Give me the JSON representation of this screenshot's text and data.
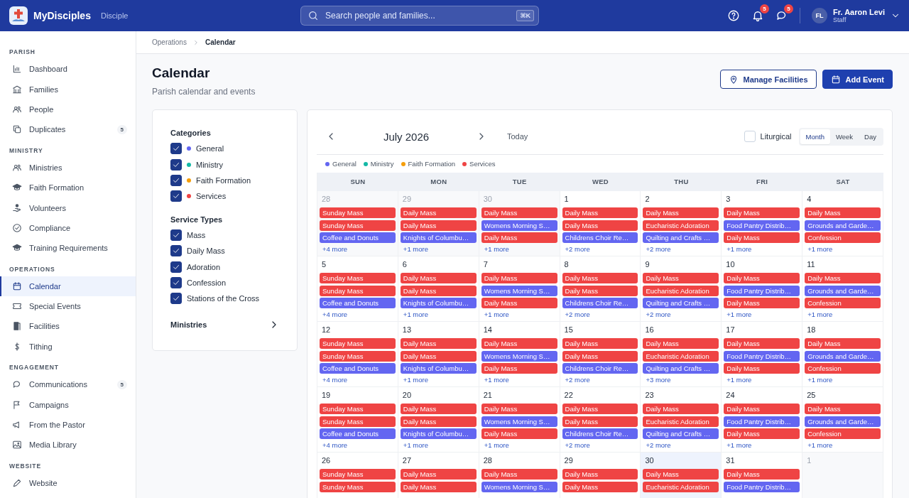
{
  "app": {
    "name": "MyDisciples",
    "edition": "Disciple"
  },
  "search": {
    "placeholder": "Search people and families...",
    "shortcut": "⌘K"
  },
  "notifications": {
    "count": "5"
  },
  "messages": {
    "count": "5"
  },
  "user": {
    "initials": "FL",
    "name": "Fr. Aaron Levi",
    "role": "Staff"
  },
  "sidebar": {
    "sections": [
      {
        "title": "PARISH",
        "items": [
          {
            "label": "Dashboard",
            "selected": false
          },
          {
            "label": "Families",
            "selected": false
          },
          {
            "label": "People",
            "selected": false
          },
          {
            "label": "Duplicates",
            "selected": false,
            "badge": "5"
          }
        ]
      },
      {
        "title": "MINISTRY",
        "items": [
          {
            "label": "Ministries",
            "selected": false
          },
          {
            "label": "Faith Formation",
            "selected": false
          },
          {
            "label": "Volunteers",
            "selected": false
          },
          {
            "label": "Compliance",
            "selected": false
          },
          {
            "label": "Training Requirements",
            "selected": false
          }
        ]
      },
      {
        "title": "OPERATIONS",
        "items": [
          {
            "label": "Calendar",
            "selected": true
          },
          {
            "label": "Special Events",
            "selected": false
          },
          {
            "label": "Facilities",
            "selected": false
          },
          {
            "label": "Tithing",
            "selected": false
          }
        ]
      },
      {
        "title": "ENGAGEMENT",
        "items": [
          {
            "label": "Communications",
            "selected": false,
            "badge": "5"
          },
          {
            "label": "Campaigns",
            "selected": false
          },
          {
            "label": "From the Pastor",
            "selected": false
          },
          {
            "label": "Media Library",
            "selected": false
          }
        ]
      },
      {
        "title": "WEBSITE",
        "items": [
          {
            "label": "Website",
            "selected": false
          }
        ]
      }
    ]
  },
  "breadcrumb": [
    "Operations",
    "Calendar"
  ],
  "page": {
    "title": "Calendar",
    "subtitle": "Parish calendar and events"
  },
  "actions": [
    {
      "label": "Manage Facilities",
      "kind": "outline"
    },
    {
      "label": "Add Event",
      "kind": "primary"
    }
  ],
  "filters": {
    "groups": [
      {
        "title": "Categories",
        "items": [
          {
            "label": "General",
            "checked": true,
            "color": "#6366f1"
          },
          {
            "label": "Ministry",
            "checked": true,
            "color": "#14b8a6"
          },
          {
            "label": "Faith Formation",
            "checked": true,
            "color": "#f59e0b"
          },
          {
            "label": "Services",
            "checked": true,
            "color": "#ef4444"
          }
        ]
      },
      {
        "title": "Service Types",
        "items": [
          {
            "label": "Mass",
            "checked": true
          },
          {
            "label": "Daily Mass",
            "checked": true
          },
          {
            "label": "Adoration",
            "checked": true
          },
          {
            "label": "Confession",
            "checked": true
          },
          {
            "label": "Stations of the Cross",
            "checked": true
          }
        ]
      }
    ],
    "ministries": {
      "label": "Ministries",
      "expanded": false
    }
  },
  "calendar": {
    "month": "July 2026",
    "today_label": "Today",
    "liturgical": {
      "label": "Liturgical",
      "checked": false
    },
    "views": [
      {
        "label": "Month",
        "selected": true
      },
      {
        "label": "Week",
        "selected": false
      },
      {
        "label": "Day",
        "selected": false
      }
    ],
    "legend": [
      {
        "label": "General",
        "color": "#6366f1"
      },
      {
        "label": "Ministry",
        "color": "#14b8a6"
      },
      {
        "label": "Faith Formation",
        "color": "#f59e0b"
      },
      {
        "label": "Services",
        "color": "#ef4444"
      }
    ],
    "weekdays": [
      "SUN",
      "MON",
      "TUE",
      "WED",
      "THU",
      "FRI",
      "SAT"
    ],
    "weeks": [
      [
        {
          "date": "28",
          "muted": true,
          "today": false,
          "events": [
            {
              "title": "Sunday Mass",
              "color": "#ef4444"
            },
            {
              "title": "Sunday Mass",
              "color": "#ef4444"
            },
            {
              "title": "Coffee and Donuts",
              "color": "#6366f1"
            }
          ],
          "more": "+4 more"
        },
        {
          "date": "29",
          "muted": true,
          "today": false,
          "events": [
            {
              "title": "Daily Mass",
              "color": "#ef4444"
            },
            {
              "title": "Daily Mass",
              "color": "#ef4444"
            },
            {
              "title": "Knights of Columbu…",
              "color": "#6366f1"
            }
          ],
          "more": "+1 more"
        },
        {
          "date": "30",
          "muted": true,
          "today": false,
          "events": [
            {
              "title": "Daily Mass",
              "color": "#ef4444"
            },
            {
              "title": "Womens Morning S…",
              "color": "#6366f1"
            },
            {
              "title": "Daily Mass",
              "color": "#ef4444"
            }
          ],
          "more": "+1 more"
        },
        {
          "date": "1",
          "muted": false,
          "today": false,
          "events": [
            {
              "title": "Daily Mass",
              "color": "#ef4444"
            },
            {
              "title": "Daily Mass",
              "color": "#ef4444"
            },
            {
              "title": "Childrens Choir Re…",
              "color": "#6366f1"
            }
          ],
          "more": "+2 more"
        },
        {
          "date": "2",
          "muted": false,
          "today": false,
          "events": [
            {
              "title": "Daily Mass",
              "color": "#ef4444"
            },
            {
              "title": "Eucharistic Adoration",
              "color": "#ef4444"
            },
            {
              "title": "Quilting and Crafts …",
              "color": "#6366f1"
            }
          ],
          "more": "+2 more"
        },
        {
          "date": "3",
          "muted": false,
          "today": false,
          "events": [
            {
              "title": "Daily Mass",
              "color": "#ef4444"
            },
            {
              "title": "Food Pantry Distrib…",
              "color": "#6366f1"
            },
            {
              "title": "Daily Mass",
              "color": "#ef4444"
            }
          ],
          "more": "+1 more"
        },
        {
          "date": "4",
          "muted": false,
          "today": false,
          "events": [
            {
              "title": "Daily Mass",
              "color": "#ef4444"
            },
            {
              "title": "Grounds and Garde…",
              "color": "#6366f1"
            },
            {
              "title": "Confession",
              "color": "#ef4444"
            }
          ],
          "more": "+1 more"
        }
      ],
      [
        {
          "date": "5",
          "muted": false,
          "today": false,
          "events": [
            {
              "title": "Sunday Mass",
              "color": "#ef4444"
            },
            {
              "title": "Sunday Mass",
              "color": "#ef4444"
            },
            {
              "title": "Coffee and Donuts",
              "color": "#6366f1"
            }
          ],
          "more": "+4 more"
        },
        {
          "date": "6",
          "muted": false,
          "today": false,
          "events": [
            {
              "title": "Daily Mass",
              "color": "#ef4444"
            },
            {
              "title": "Daily Mass",
              "color": "#ef4444"
            },
            {
              "title": "Knights of Columbu…",
              "color": "#6366f1"
            }
          ],
          "more": "+1 more"
        },
        {
          "date": "7",
          "muted": false,
          "today": false,
          "events": [
            {
              "title": "Daily Mass",
              "color": "#ef4444"
            },
            {
              "title": "Womens Morning S…",
              "color": "#6366f1"
            },
            {
              "title": "Daily Mass",
              "color": "#ef4444"
            }
          ],
          "more": "+1 more"
        },
        {
          "date": "8",
          "muted": false,
          "today": false,
          "events": [
            {
              "title": "Daily Mass",
              "color": "#ef4444"
            },
            {
              "title": "Daily Mass",
              "color": "#ef4444"
            },
            {
              "title": "Childrens Choir Re…",
              "color": "#6366f1"
            }
          ],
          "more": "+2 more"
        },
        {
          "date": "9",
          "muted": false,
          "today": false,
          "events": [
            {
              "title": "Daily Mass",
              "color": "#ef4444"
            },
            {
              "title": "Eucharistic Adoration",
              "color": "#ef4444"
            },
            {
              "title": "Quilting and Crafts …",
              "color": "#6366f1"
            }
          ],
          "more": "+2 more"
        },
        {
          "date": "10",
          "muted": false,
          "today": false,
          "events": [
            {
              "title": "Daily Mass",
              "color": "#ef4444"
            },
            {
              "title": "Food Pantry Distrib…",
              "color": "#6366f1"
            },
            {
              "title": "Daily Mass",
              "color": "#ef4444"
            }
          ],
          "more": "+1 more"
        },
        {
          "date": "11",
          "muted": false,
          "today": false,
          "events": [
            {
              "title": "Daily Mass",
              "color": "#ef4444"
            },
            {
              "title": "Grounds and Garde…",
              "color": "#6366f1"
            },
            {
              "title": "Confession",
              "color": "#ef4444"
            }
          ],
          "more": "+1 more"
        }
      ],
      [
        {
          "date": "12",
          "muted": false,
          "today": false,
          "events": [
            {
              "title": "Sunday Mass",
              "color": "#ef4444"
            },
            {
              "title": "Sunday Mass",
              "color": "#ef4444"
            },
            {
              "title": "Coffee and Donuts",
              "color": "#6366f1"
            }
          ],
          "more": "+4 more"
        },
        {
          "date": "13",
          "muted": false,
          "today": false,
          "events": [
            {
              "title": "Daily Mass",
              "color": "#ef4444"
            },
            {
              "title": "Daily Mass",
              "color": "#ef4444"
            },
            {
              "title": "Knights of Columbu…",
              "color": "#6366f1"
            }
          ],
          "more": "+1 more"
        },
        {
          "date": "14",
          "muted": false,
          "today": false,
          "events": [
            {
              "title": "Daily Mass",
              "color": "#ef4444"
            },
            {
              "title": "Womens Morning S…",
              "color": "#6366f1"
            },
            {
              "title": "Daily Mass",
              "color": "#ef4444"
            }
          ],
          "more": "+1 more"
        },
        {
          "date": "15",
          "muted": false,
          "today": false,
          "events": [
            {
              "title": "Daily Mass",
              "color": "#ef4444"
            },
            {
              "title": "Daily Mass",
              "color": "#ef4444"
            },
            {
              "title": "Childrens Choir Re…",
              "color": "#6366f1"
            }
          ],
          "more": "+2 more"
        },
        {
          "date": "16",
          "muted": false,
          "today": false,
          "events": [
            {
              "title": "Daily Mass",
              "color": "#ef4444"
            },
            {
              "title": "Eucharistic Adoration",
              "color": "#ef4444"
            },
            {
              "title": "Quilting and Crafts …",
              "color": "#6366f1"
            }
          ],
          "more": "+3 more"
        },
        {
          "date": "17",
          "muted": false,
          "today": false,
          "events": [
            {
              "title": "Daily Mass",
              "color": "#ef4444"
            },
            {
              "title": "Food Pantry Distrib…",
              "color": "#6366f1"
            },
            {
              "title": "Daily Mass",
              "color": "#ef4444"
            }
          ],
          "more": "+1 more"
        },
        {
          "date": "18",
          "muted": false,
          "today": false,
          "events": [
            {
              "title": "Daily Mass",
              "color": "#ef4444"
            },
            {
              "title": "Grounds and Garde…",
              "color": "#6366f1"
            },
            {
              "title": "Confession",
              "color": "#ef4444"
            }
          ],
          "more": "+1 more"
        }
      ],
      [
        {
          "date": "19",
          "muted": false,
          "today": false,
          "events": [
            {
              "title": "Sunday Mass",
              "color": "#ef4444"
            },
            {
              "title": "Sunday Mass",
              "color": "#ef4444"
            },
            {
              "title": "Coffee and Donuts",
              "color": "#6366f1"
            }
          ],
          "more": "+4 more"
        },
        {
          "date": "20",
          "muted": false,
          "today": false,
          "events": [
            {
              "title": "Daily Mass",
              "color": "#ef4444"
            },
            {
              "title": "Daily Mass",
              "color": "#ef4444"
            },
            {
              "title": "Knights of Columbu…",
              "color": "#6366f1"
            }
          ],
          "more": "+1 more"
        },
        {
          "date": "21",
          "muted": false,
          "today": false,
          "events": [
            {
              "title": "Daily Mass",
              "color": "#ef4444"
            },
            {
              "title": "Womens Morning S…",
              "color": "#6366f1"
            },
            {
              "title": "Daily Mass",
              "color": "#ef4444"
            }
          ],
          "more": "+1 more"
        },
        {
          "date": "22",
          "muted": false,
          "today": false,
          "events": [
            {
              "title": "Daily Mass",
              "color": "#ef4444"
            },
            {
              "title": "Daily Mass",
              "color": "#ef4444"
            },
            {
              "title": "Childrens Choir Re…",
              "color": "#6366f1"
            }
          ],
          "more": "+2 more"
        },
        {
          "date": "23",
          "muted": false,
          "today": false,
          "events": [
            {
              "title": "Daily Mass",
              "color": "#ef4444"
            },
            {
              "title": "Eucharistic Adoration",
              "color": "#ef4444"
            },
            {
              "title": "Quilting and Crafts …",
              "color": "#6366f1"
            }
          ],
          "more": "+2 more"
        },
        {
          "date": "24",
          "muted": false,
          "today": false,
          "events": [
            {
              "title": "Daily Mass",
              "color": "#ef4444"
            },
            {
              "title": "Food Pantry Distrib…",
              "color": "#6366f1"
            },
            {
              "title": "Daily Mass",
              "color": "#ef4444"
            }
          ],
          "more": "+1 more"
        },
        {
          "date": "25",
          "muted": false,
          "today": false,
          "events": [
            {
              "title": "Daily Mass",
              "color": "#ef4444"
            },
            {
              "title": "Grounds and Garde…",
              "color": "#6366f1"
            },
            {
              "title": "Confession",
              "color": "#ef4444"
            }
          ],
          "more": "+1 more"
        }
      ],
      [
        {
          "date": "26",
          "muted": false,
          "today": false,
          "events": [
            {
              "title": "Sunday Mass",
              "color": "#ef4444"
            },
            {
              "title": "Sunday Mass",
              "color": "#ef4444"
            }
          ]
        },
        {
          "date": "27",
          "muted": false,
          "today": false,
          "events": [
            {
              "title": "Daily Mass",
              "color": "#ef4444"
            },
            {
              "title": "Daily Mass",
              "color": "#ef4444"
            }
          ]
        },
        {
          "date": "28",
          "muted": false,
          "today": false,
          "events": [
            {
              "title": "Daily Mass",
              "color": "#ef4444"
            },
            {
              "title": "Womens Morning S…",
              "color": "#6366f1"
            }
          ]
        },
        {
          "date": "29",
          "muted": false,
          "today": false,
          "events": [
            {
              "title": "Daily Mass",
              "color": "#ef4444"
            },
            {
              "title": "Daily Mass",
              "color": "#ef4444"
            }
          ]
        },
        {
          "date": "30",
          "muted": false,
          "today": true,
          "events": [
            {
              "title": "Daily Mass",
              "color": "#ef4444"
            },
            {
              "title": "Eucharistic Adoration",
              "color": "#ef4444"
            }
          ]
        },
        {
          "date": "31",
          "muted": false,
          "today": false,
          "events": [
            {
              "title": "Daily Mass",
              "color": "#ef4444"
            },
            {
              "title": "Food Pantry Distrib…",
              "color": "#6366f1"
            }
          ]
        },
        {
          "date": "1",
          "muted": true,
          "today": false
        }
      ]
    ]
  }
}
